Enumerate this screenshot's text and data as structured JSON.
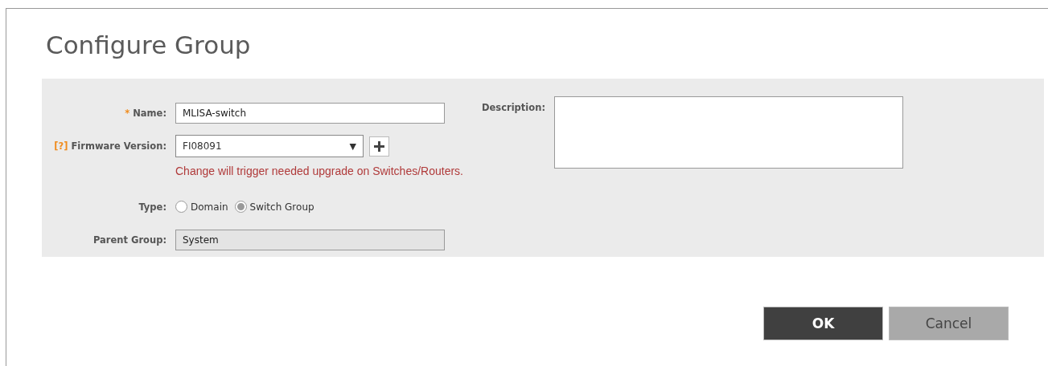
{
  "dialog": {
    "title": "Configure Group"
  },
  "form": {
    "name": {
      "required_mark": "*",
      "label": "Name:",
      "value": "MLISA-switch"
    },
    "firmware": {
      "help_mark": "[?]",
      "label": "Firmware Version:",
      "value": "FI08091",
      "arrow": "▼",
      "warning": "Change will trigger needed upgrade on Switches/Routers."
    },
    "type": {
      "label": "Type:",
      "options": [
        {
          "label": "Domain",
          "selected": false
        },
        {
          "label": "Switch Group",
          "selected": true
        }
      ]
    },
    "parent_group": {
      "label": "Parent Group:",
      "value": "System",
      "disabled": true
    },
    "description": {
      "label": "Description:"
    }
  },
  "buttons": [
    {
      "label": "OK",
      "kind": "primary"
    },
    {
      "label": "Cancel",
      "kind": "secondary"
    }
  ]
}
